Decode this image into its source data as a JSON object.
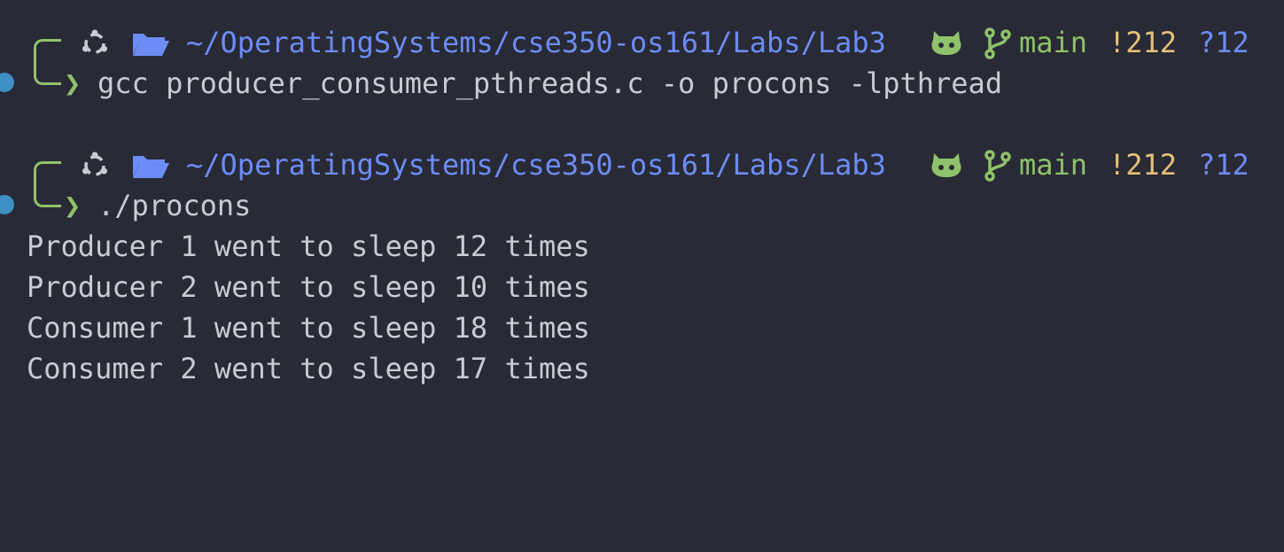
{
  "prompts": [
    {
      "path": "~/OperatingSystems/cse350-os161/Labs/Lab3",
      "branch": "main",
      "modified": "!212",
      "untracked": "?12",
      "arrow": "❯",
      "command": "gcc producer_consumer_pthreads.c -o procons -lpthread"
    },
    {
      "path": "~/OperatingSystems/cse350-os161/Labs/Lab3",
      "branch": "main",
      "modified": "!212",
      "untracked": "?12",
      "arrow": "❯",
      "command": "./procons"
    }
  ],
  "output": [
    "Producer 1 went to sleep 12 times",
    "Producer 2 went to sleep 10 times",
    "Consumer 1 went to sleep 18 times",
    "Consumer 2 went to sleep 17 times"
  ],
  "colors": {
    "background": "#282a35",
    "text": "#c8cbd4",
    "path": "#6d8cf5",
    "git": "#8fc26a",
    "modified": "#e5c07b",
    "untracked": "#6d8cf5",
    "dot": "#3f8fc4"
  },
  "icons": [
    "ubuntu-icon",
    "folder-icon",
    "github-icon",
    "git-branch-icon"
  ]
}
